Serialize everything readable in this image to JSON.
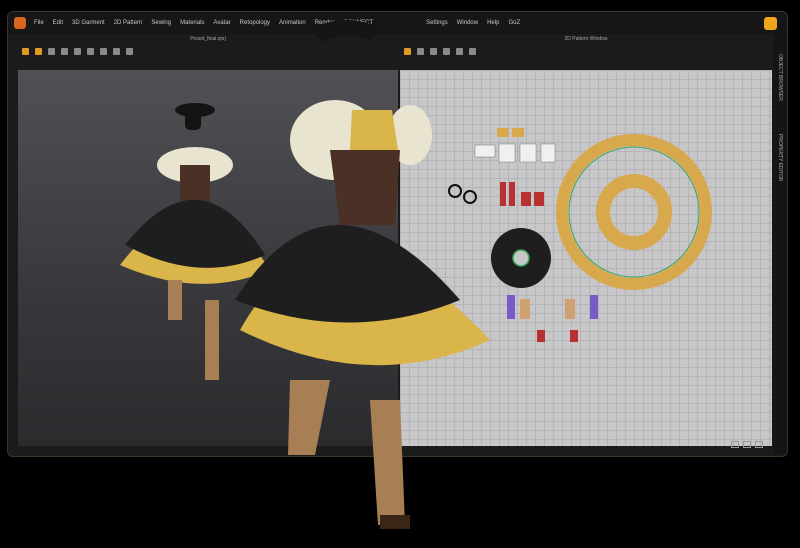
{
  "menu": [
    "File",
    "Edit",
    "3D Garment",
    "2D Pattern",
    "Sewing",
    "Materials",
    "Avatar",
    "Retopology",
    "Animation",
    "Render",
    "CONNECT",
    "Settings",
    "Window",
    "Help",
    "GoZ"
  ],
  "panels": {
    "left_title": "Posed_final.zprj",
    "right_title": "2D Pattern Window"
  },
  "side_tabs": [
    "OBJECT BROWSER",
    "PROPERTY EDITOR"
  ],
  "colors": {
    "accent": "#f0a51a",
    "pattern_gold": "#d8a94c",
    "skirt_black": "#1e1e1e",
    "petticoat_yellow": "#d9b54a",
    "blouse": "#e8e4d0",
    "boots": "#a87f55",
    "corset": "#4a3025"
  },
  "icons": [
    "select-icon",
    "move-icon",
    "rotate-icon",
    "scale-icon",
    "pin-icon",
    "fold-icon",
    "brush-icon",
    "sewing-icon",
    "avatar-icon"
  ]
}
